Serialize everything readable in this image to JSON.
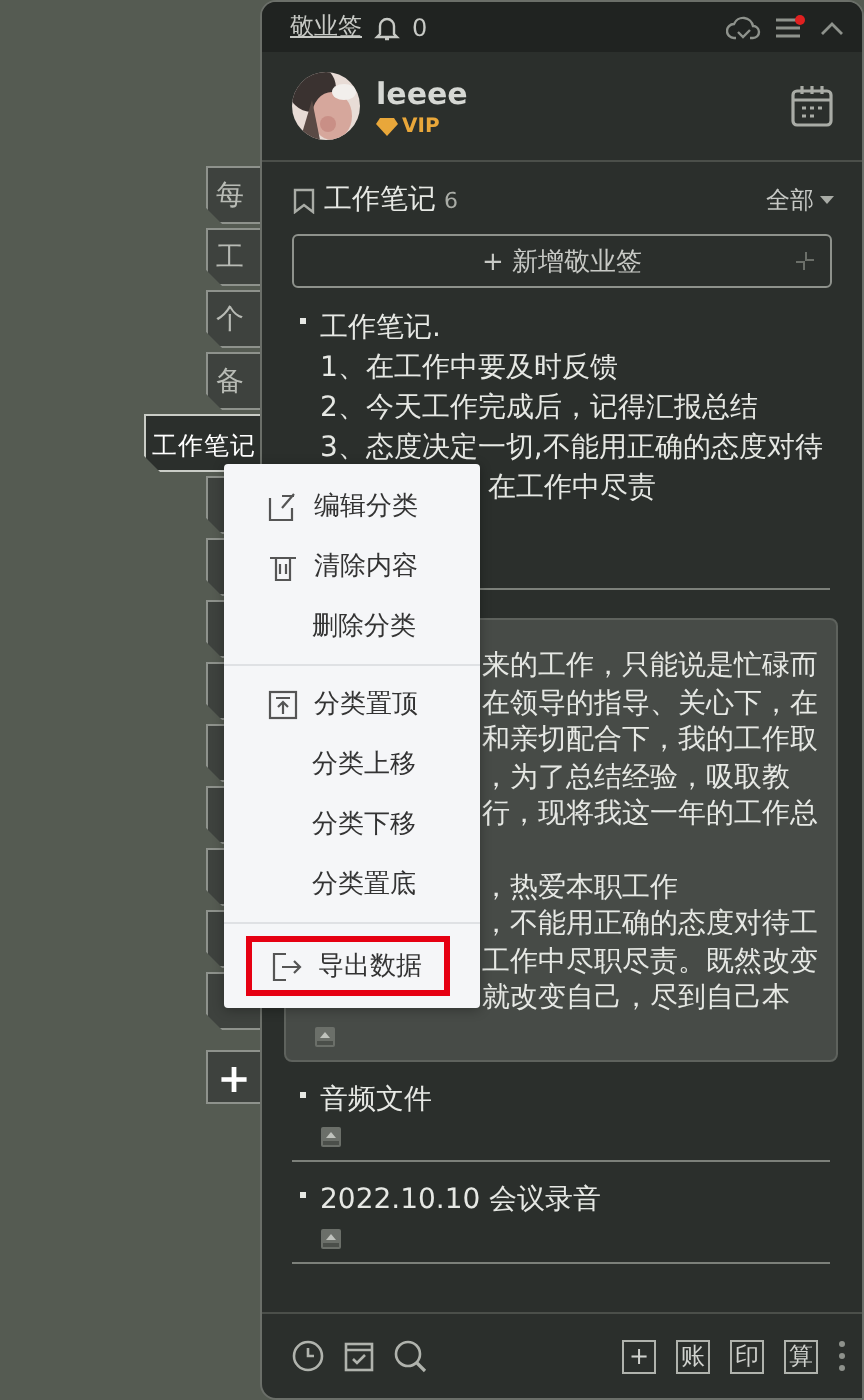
{
  "side_tabs": [
    {
      "label": "每",
      "selected": false
    },
    {
      "label": "工",
      "selected": false
    },
    {
      "label": "个",
      "selected": false
    },
    {
      "label": "备",
      "selected": false
    },
    {
      "label": "工作笔记",
      "selected": true
    },
    {
      "selected": false
    },
    {
      "selected": false
    },
    {
      "selected": false
    },
    {
      "selected": false
    },
    {
      "selected": false
    },
    {
      "selected": false
    },
    {
      "selected": false
    },
    {
      "selected": false
    },
    {
      "selected": false
    }
  ],
  "add_tab": "+",
  "titlebar": {
    "app_name": "敬业签",
    "notifications": "0",
    "menu_has_badge": true
  },
  "user": {
    "name": "leeee",
    "badge": "VIP"
  },
  "category": {
    "title": "工作笔记",
    "count": "6",
    "filter": "全部"
  },
  "new_note_button": "+ 新增敬业签",
  "notes": [
    {
      "kind": "text",
      "lines": [
        "工作笔记.",
        "1、在工作中要及时反馈",
        "2、今天工作完成后，记得汇报总结",
        "3、态度决定一切,不能用正确的态度对待",
        "在工作中尽责"
      ]
    },
    {
      "kind": "card",
      "highlighted": true,
      "paragraphs": [
        [
          "来的工作，只能说是忙碌而",
          "在领导的指导、关心下，在",
          "和亲切配合下，我的工作取",
          "，为了总结经验，吸取教",
          "行，现将我这一年的工作总"
        ],
        [
          "，热爱本职工作",
          "，不能用正确的态度对待工",
          "工作中尽职尽责。既然改变",
          "就改变自己，尽到自己本"
        ]
      ],
      "attachment": true
    },
    {
      "kind": "text",
      "lines": [
        "音频文件"
      ],
      "attachment": true
    },
    {
      "kind": "text",
      "lines": [
        "2022.10.10 会议录音"
      ],
      "attachment": true
    }
  ],
  "toolbar": {
    "right_buttons": [
      "+",
      "账",
      "印",
      "算"
    ]
  },
  "context_menu": [
    {
      "label": "编辑分类",
      "highlighted": false
    },
    {
      "label": "清除内容",
      "highlighted": false
    },
    {
      "label": "删除分类",
      "highlighted": false
    },
    {
      "kind": "divider"
    },
    {
      "label": "分类置顶",
      "highlighted": false
    },
    {
      "label": "分类上移",
      "highlighted": false
    },
    {
      "label": "分类下移",
      "highlighted": false
    },
    {
      "label": "分类置底",
      "highlighted": false
    },
    {
      "kind": "divider"
    },
    {
      "label": "导出数据",
      "highlighted": true
    }
  ]
}
